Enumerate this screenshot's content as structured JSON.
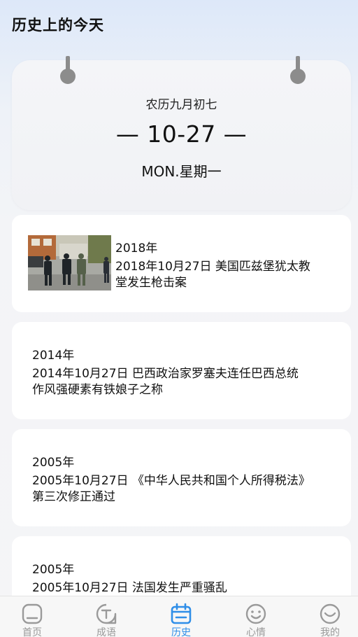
{
  "header": {
    "title": "历史上的今天"
  },
  "calendar": {
    "lunar_date": "农历九月初七",
    "date": "— 10-27 —",
    "weekday": "MON.星期一"
  },
  "events": [
    {
      "year": "2018年",
      "desc_line1": "2018年10月27日 美国匹兹堡犹太教",
      "desc_line2": "堂发生枪击案",
      "has_image": true
    },
    {
      "year": "2014年",
      "desc_line1": "2014年10月27日 巴西政治家罗塞夫连任巴西总统",
      "desc_line2": "作风强硬素有铁娘子之称"
    },
    {
      "year": "2005年",
      "desc_line1": "2005年10月27日 《中华人民共和国个人所得税法》",
      "desc_line2": "第三次修正通过"
    },
    {
      "year": "2005年",
      "desc_line1": "2005年10月27日 法国发生严重骚乱",
      "desc_line2": ""
    }
  ],
  "nav": {
    "items": [
      {
        "label": "首页",
        "icon": "home-icon"
      },
      {
        "label": "成语",
        "icon": "idiom-icon"
      },
      {
        "label": "历史",
        "icon": "calendar-icon"
      },
      {
        "label": "心情",
        "icon": "smile-icon"
      },
      {
        "label": "我的",
        "icon": "profile-icon"
      }
    ],
    "active_color": "#2f8ee8",
    "inactive_color": "#9a9a9a"
  }
}
